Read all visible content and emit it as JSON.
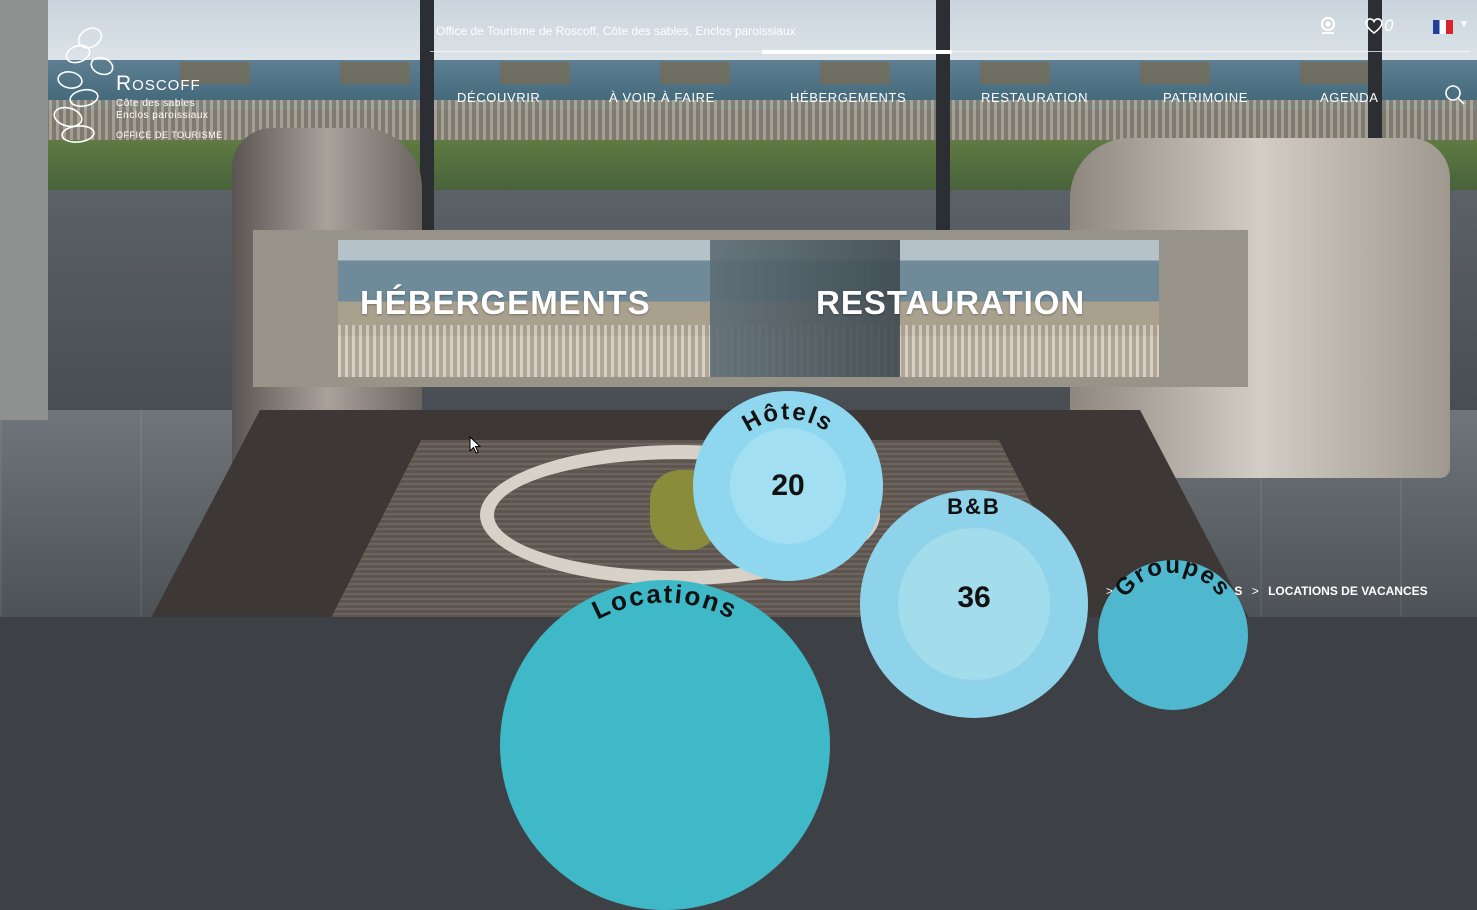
{
  "header": {
    "office_text": "Office de Tourisme de Roscoff, Côte des sables, Enclos paroissiaux",
    "favorites_count": "0",
    "language": "fr"
  },
  "logo": {
    "title": "Roscoff",
    "line1": "Côte des sables",
    "line2": "Enclos paroissiaux",
    "line3": "OFFICE DE TOURISME"
  },
  "nav": {
    "items": [
      {
        "label": "DÉCOUVRIR"
      },
      {
        "label": "À VOIR À FAIRE"
      },
      {
        "label": "HÉBERGEMENTS"
      },
      {
        "label": "RESTAURATION"
      },
      {
        "label": "PATRIMOINE"
      },
      {
        "label": "AGENDA"
      }
    ]
  },
  "banner": {
    "left": "HÉBERGEMENTS",
    "right": "RESTAURATION"
  },
  "bubbles": {
    "hotels": {
      "title": "Hôtels",
      "count": "20"
    },
    "bnb": {
      "title": "B&B",
      "count": "36"
    },
    "locations": {
      "title": "Locations"
    },
    "groups": {
      "title": "Groupes"
    }
  },
  "breadcrumb": {
    "prev": "S",
    "current": "LOCATIONS DE VACANCES"
  }
}
